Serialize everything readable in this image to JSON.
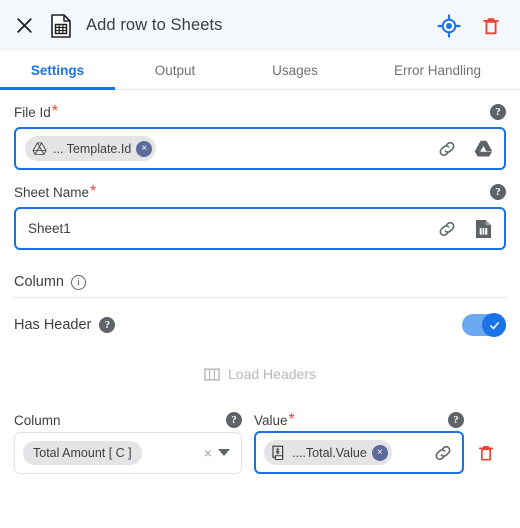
{
  "header": {
    "title": "Add row to Sheets",
    "close_label": "×",
    "app_icon": "sheets-file-icon",
    "locate_icon": "target-crosshair-icon",
    "delete_icon": "trash-icon"
  },
  "tabs": [
    {
      "label": "Settings",
      "active": true
    },
    {
      "label": "Output",
      "active": false
    },
    {
      "label": "Usages",
      "active": false
    },
    {
      "label": "Error Handling",
      "active": false
    }
  ],
  "fields": {
    "file_id": {
      "label": "File Id",
      "required_marker": "*",
      "help": "?",
      "chip": {
        "icon": "google-drive-icon",
        "text": "... Template.Id",
        "remove": "×"
      },
      "link_icon": "link-chain-icon",
      "source_icon": "google-drive-icon"
    },
    "sheet_name": {
      "label": "Sheet Name",
      "required_marker": "*",
      "help": "?",
      "value": "Sheet1",
      "link_icon": "link-chain-icon",
      "source_icon": "sheet-document-icon"
    }
  },
  "column_section": {
    "title": "Column",
    "info": "i",
    "has_header": {
      "label": "Has Header",
      "help": "?",
      "enabled": true,
      "check": "✓"
    },
    "load_headers": {
      "label": "Load Headers",
      "icon": "columns-icon",
      "disabled": true
    },
    "row": {
      "column_label": "Column",
      "column_help": "?",
      "column_value": "Total Amount [ C ]",
      "column_clear": "×",
      "value_label": "Value",
      "value_required_marker": "*",
      "value_help": "?",
      "value_chip": {
        "icon": "invoice-dollar-icon",
        "text": "....Total.Value",
        "remove": "×"
      },
      "value_link_icon": "link-chain-icon",
      "delete_icon": "trash-icon"
    }
  },
  "colors": {
    "accent": "#1a73e8",
    "danger": "#ea4335",
    "header_bg": "#f4f7fc",
    "chip_bg": "#e4e4e6",
    "chip_x_bg": "#5c6b99",
    "muted": "#9aa0a6"
  }
}
